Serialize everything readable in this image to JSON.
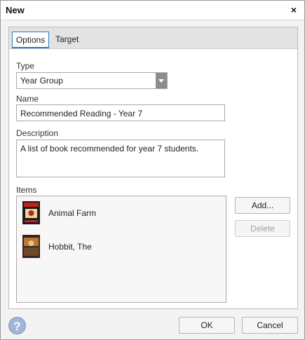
{
  "dialog": {
    "title": "New",
    "close_glyph": "×"
  },
  "tabs": [
    {
      "label": "Options",
      "active": true
    },
    {
      "label": "Target",
      "active": false
    }
  ],
  "form": {
    "type_label": "Type",
    "type_value": "Year Group",
    "name_label": "Name",
    "name_value": "Recommended Reading - Year 7",
    "description_label": "Description",
    "description_value": "A list of book recommended for year 7 students.",
    "items_label": "Items"
  },
  "items": [
    {
      "title": "Animal Farm",
      "thumb_colors": [
        "#1b1b1b",
        "#c21f1f",
        "#e6d6a0"
      ]
    },
    {
      "title": "Hobbit, The",
      "thumb_colors": [
        "#3b2418",
        "#b9753a",
        "#6e4a2a"
      ]
    }
  ],
  "buttons": {
    "add": "Add...",
    "delete": "Delete",
    "ok": "OK",
    "cancel": "Cancel"
  },
  "help_icon": {
    "glyph": "?"
  },
  "colors": {
    "accent": "#2b79c2",
    "help": "#9fb7d6"
  }
}
